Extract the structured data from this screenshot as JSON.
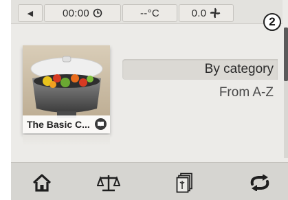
{
  "status_bar": {
    "back_icon": "triangle-left-icon",
    "time": "00:00",
    "time_icon": "clock-icon",
    "temperature": "--°C",
    "speed": "0.0",
    "speed_icon": "fan-icon"
  },
  "step_badge": "2",
  "recipe_card": {
    "title": "The Basic C...",
    "badge_icon": "book-icon"
  },
  "menu": {
    "items": [
      {
        "label": "By category",
        "selected": true
      },
      {
        "label": "From A-Z",
        "selected": false
      }
    ]
  },
  "bottom_bar": {
    "icons": [
      "home-icon",
      "scale-icon",
      "recipes-icon",
      "reverse-icon"
    ]
  },
  "colors": {
    "background": "#ecebe8",
    "status_bar": "#e3e2de",
    "bottom_bar": "#d6d5d1",
    "selected_item": "#dbd9d4"
  }
}
